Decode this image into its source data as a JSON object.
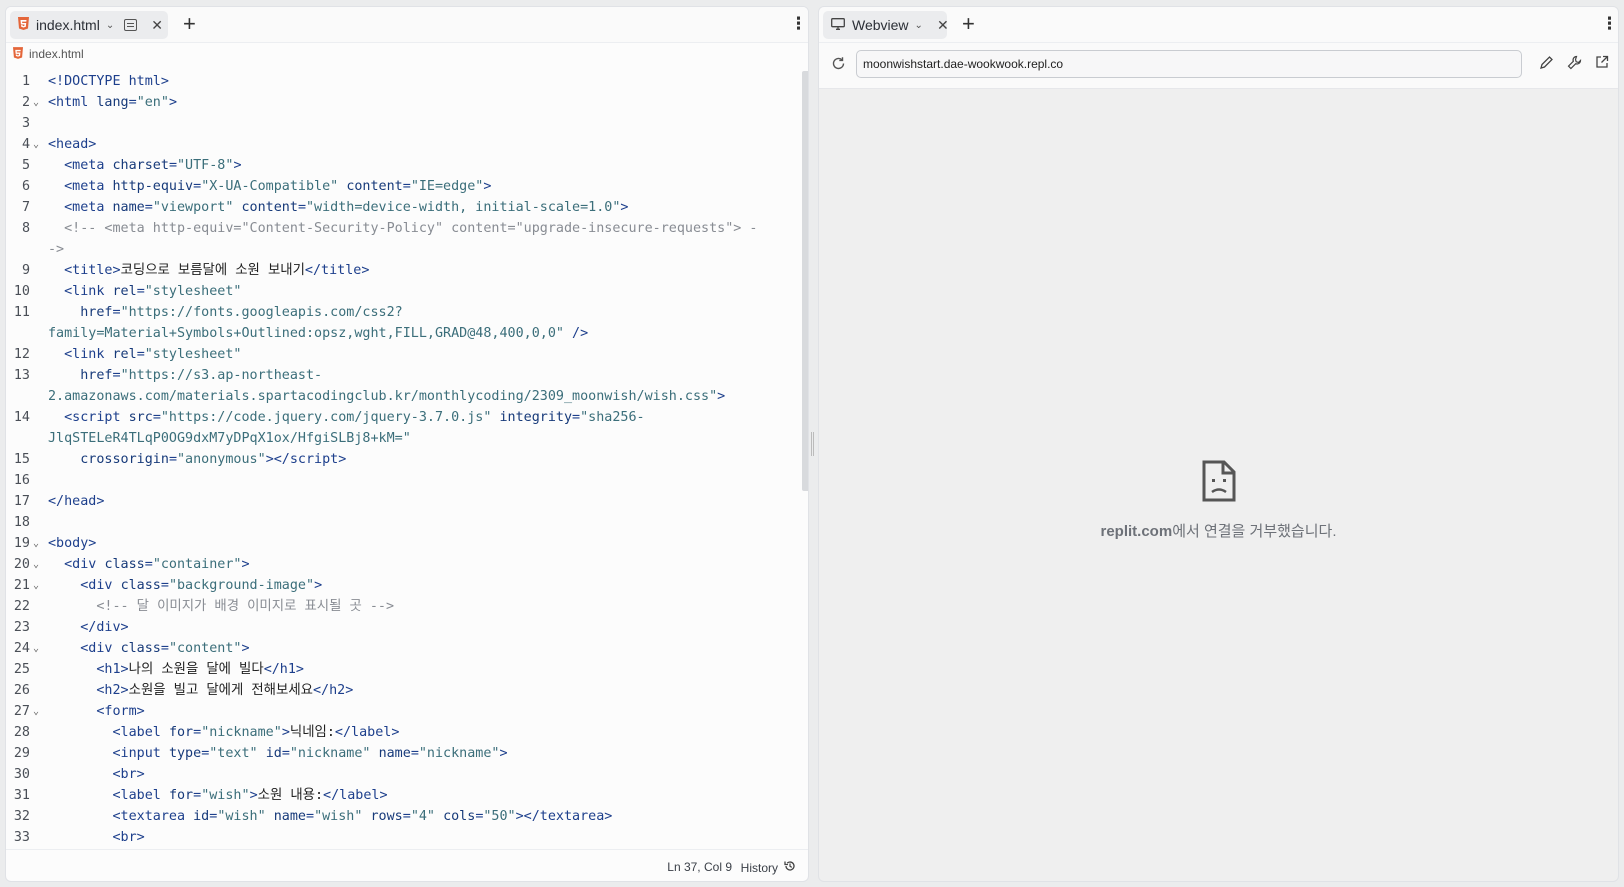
{
  "editor": {
    "tab_label": "index.html",
    "breadcrumb": "index.html",
    "status_position": "Ln 37, Col 9",
    "history_label": "History",
    "lines": [
      {
        "n": "1",
        "fold": false,
        "h": "<span class='t'>&lt;!DOCTYPE html&gt;</span>"
      },
      {
        "n": "2",
        "fold": true,
        "h": "<span class='t'>&lt;html </span><span class='a'>lang</span><span class='t'>=</span><span class='s'>\"en\"</span><span class='t'>&gt;</span>"
      },
      {
        "n": "3",
        "fold": false,
        "h": ""
      },
      {
        "n": "4",
        "fold": true,
        "h": "<span class='t'>&lt;head&gt;</span>"
      },
      {
        "n": "5",
        "fold": false,
        "h": "  <span class='t'>&lt;meta </span><span class='a'>charset</span><span class='t'>=</span><span class='s'>\"UTF-8\"</span><span class='t'>&gt;</span>"
      },
      {
        "n": "6",
        "fold": false,
        "h": "  <span class='t'>&lt;meta </span><span class='a'>http-equiv</span><span class='t'>=</span><span class='s'>\"X-UA-Compatible\"</span> <span class='a'>content</span><span class='t'>=</span><span class='s'>\"IE=edge\"</span><span class='t'>&gt;</span>"
      },
      {
        "n": "7",
        "fold": false,
        "h": "  <span class='t'>&lt;meta </span><span class='a'>name</span><span class='t'>=</span><span class='s'>\"viewport\"</span> <span class='a'>content</span><span class='t'>=</span><span class='s'>\"width=device-width, initial-scale=1.0\"</span><span class='t'>&gt;</span>"
      },
      {
        "n": "8",
        "fold": false,
        "h": "  <span class='c'>&lt;!-- &lt;meta http-equiv=\"Content-Security-Policy\" content=\"upgrade-insecure-requests\"&gt; -</span>"
      },
      {
        "n": "",
        "fold": false,
        "h": "<span class='c'>-&gt;</span>"
      },
      {
        "n": "9",
        "fold": false,
        "h": "  <span class='t'>&lt;title&gt;</span><span class='tx'>코딩으로 보름달에 소원 보내기</span><span class='t'>&lt;/title&gt;</span>"
      },
      {
        "n": "10",
        "fold": false,
        "h": "  <span class='t'>&lt;link </span><span class='a'>rel</span><span class='t'>=</span><span class='s'>\"stylesheet\"</span>"
      },
      {
        "n": "11",
        "fold": false,
        "h": "    <span class='a'>href</span><span class='t'>=</span><span class='s'>\"https://fonts.googleapis.com/css2?</span>"
      },
      {
        "n": "",
        "fold": false,
        "h": "<span class='s'>family=Material+Symbols+Outlined:opsz,wght,FILL,GRAD@48,400,0,0\"</span> <span class='t'>/&gt;</span>"
      },
      {
        "n": "12",
        "fold": false,
        "h": "  <span class='t'>&lt;link </span><span class='a'>rel</span><span class='t'>=</span><span class='s'>\"stylesheet\"</span>"
      },
      {
        "n": "13",
        "fold": false,
        "h": "    <span class='a'>href</span><span class='t'>=</span><span class='s'>\"https://s3.ap-northeast-</span>"
      },
      {
        "n": "",
        "fold": false,
        "h": "<span class='s'>2.amazonaws.com/materials.spartacodingclub.kr/monthlycoding/2309_moonwish/wish.css\"</span><span class='t'>&gt;</span>"
      },
      {
        "n": "14",
        "fold": false,
        "h": "  <span class='t'>&lt;script </span><span class='a'>src</span><span class='t'>=</span><span class='s'>\"https://code.jquery.com/jquery-3.7.0.js\"</span> <span class='a'>integrity</span><span class='t'>=</span><span class='s'>\"sha256-</span>"
      },
      {
        "n": "",
        "fold": false,
        "h": "<span class='s'>JlqSTELeR4TLqP0OG9dxM7yDPqX1ox/HfgiSLBj8+kM=\"</span>"
      },
      {
        "n": "15",
        "fold": false,
        "h": "    <span class='a'>crossorigin</span><span class='t'>=</span><span class='s'>\"anonymous\"</span><span class='t'>&gt;&lt;/script&gt;</span>"
      },
      {
        "n": "16",
        "fold": false,
        "h": ""
      },
      {
        "n": "17",
        "fold": false,
        "h": "<span class='t'>&lt;/head&gt;</span>"
      },
      {
        "n": "18",
        "fold": false,
        "h": ""
      },
      {
        "n": "19",
        "fold": true,
        "h": "<span class='t'>&lt;body&gt;</span>"
      },
      {
        "n": "20",
        "fold": true,
        "h": "  <span class='t'>&lt;div </span><span class='a'>class</span><span class='t'>=</span><span class='s'>\"container\"</span><span class='t'>&gt;</span>"
      },
      {
        "n": "21",
        "fold": true,
        "h": "    <span class='t'>&lt;div </span><span class='a'>class</span><span class='t'>=</span><span class='s'>\"background-image\"</span><span class='t'>&gt;</span>"
      },
      {
        "n": "22",
        "fold": false,
        "h": "      <span class='c'>&lt;!-- 달 이미지가 배경 이미지로 표시될 곳 --&gt;</span>"
      },
      {
        "n": "23",
        "fold": false,
        "h": "    <span class='t'>&lt;/div&gt;</span>"
      },
      {
        "n": "24",
        "fold": true,
        "h": "    <span class='t'>&lt;div </span><span class='a'>class</span><span class='t'>=</span><span class='s'>\"content\"</span><span class='t'>&gt;</span>"
      },
      {
        "n": "25",
        "fold": false,
        "h": "      <span class='t'>&lt;h1&gt;</span><span class='tx'>나의 소원을 달에 빌다</span><span class='t'>&lt;/h1&gt;</span>"
      },
      {
        "n": "26",
        "fold": false,
        "h": "      <span class='t'>&lt;h2&gt;</span><span class='tx'>소원을 빌고 달에게 전해보세요</span><span class='t'>&lt;/h2&gt;</span>"
      },
      {
        "n": "27",
        "fold": true,
        "h": "      <span class='t'>&lt;form&gt;</span>"
      },
      {
        "n": "28",
        "fold": false,
        "h": "        <span class='t'>&lt;label </span><span class='a'>for</span><span class='t'>=</span><span class='s'>\"nickname\"</span><span class='t'>&gt;</span><span class='tx'>닉네임:</span><span class='t'>&lt;/label&gt;</span>"
      },
      {
        "n": "29",
        "fold": false,
        "h": "        <span class='t'>&lt;input </span><span class='a'>type</span><span class='t'>=</span><span class='s'>\"text\"</span> <span class='a'>id</span><span class='t'>=</span><span class='s'>\"nickname\"</span> <span class='a'>name</span><span class='t'>=</span><span class='s'>\"nickname\"</span><span class='t'>&gt;</span>"
      },
      {
        "n": "30",
        "fold": false,
        "h": "        <span class='t'>&lt;br&gt;</span>"
      },
      {
        "n": "31",
        "fold": false,
        "h": "        <span class='t'>&lt;label </span><span class='a'>for</span><span class='t'>=</span><span class='s'>\"wish\"</span><span class='t'>&gt;</span><span class='tx'>소원 내용:</span><span class='t'>&lt;/label&gt;</span>"
      },
      {
        "n": "32",
        "fold": false,
        "h": "        <span class='t'>&lt;textarea </span><span class='a'>id</span><span class='t'>=</span><span class='s'>\"wish\"</span> <span class='a'>name</span><span class='t'>=</span><span class='s'>\"wish\"</span> <span class='a'>rows</span><span class='t'>=</span><span class='s'>\"4\"</span> <span class='a'>cols</span><span class='t'>=</span><span class='s'>\"50\"</span><span class='t'>&gt;&lt;/textarea&gt;</span>"
      },
      {
        "n": "33",
        "fold": false,
        "h": "        <span class='t'>&lt;br&gt;</span>"
      }
    ]
  },
  "webview": {
    "tab_label": "Webview",
    "url": "moonwishstart.dae-wookwook.repl.co",
    "error_domain": "replit.com",
    "error_message": "에서 연결을 거부했습니다."
  },
  "icons": {
    "html": "html5-file-icon",
    "monitor": "monitor-icon",
    "reload": "reload-icon",
    "edit": "pencil-icon",
    "devtools": "wrench-icon",
    "external": "open-external-icon",
    "history": "history-icon",
    "error": "sad-file-icon"
  }
}
